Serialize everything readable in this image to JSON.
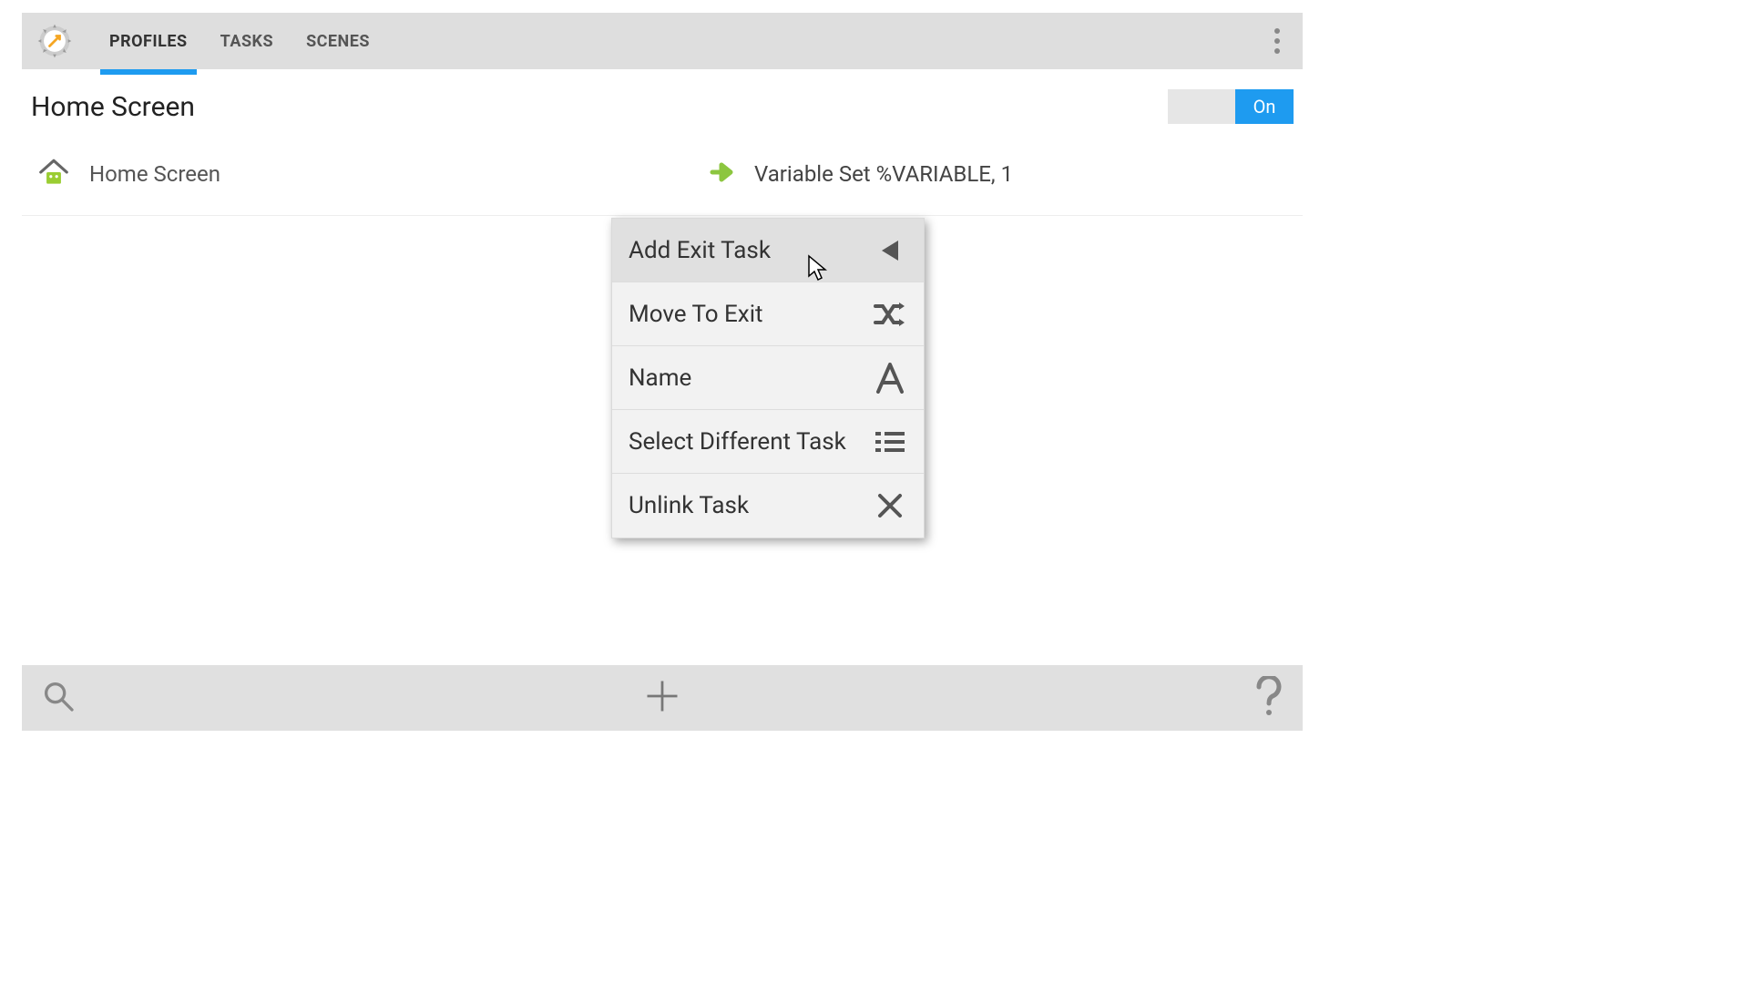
{
  "header": {
    "tabs": [
      "PROFILES",
      "TASKS",
      "SCENES"
    ],
    "active_tab": 0
  },
  "title": "Home Screen",
  "toggle_state": "On",
  "profile": {
    "context_name": "Home Screen",
    "enter_task": "Variable Set %VARIABLE, 1"
  },
  "context_menu": {
    "items": [
      {
        "label": "Add Exit Task",
        "icon": "triangle-left-icon"
      },
      {
        "label": "Move To Exit",
        "icon": "shuffle-icon"
      },
      {
        "label": "Name",
        "icon": "letter-a-icon"
      },
      {
        "label": "Select Different Task",
        "icon": "list-icon"
      },
      {
        "label": "Unlink Task",
        "icon": "close-icon"
      }
    ],
    "hovered_index": 0
  },
  "colors": {
    "accent": "#1e9bf0",
    "task_arrow": "#8cc63f"
  }
}
